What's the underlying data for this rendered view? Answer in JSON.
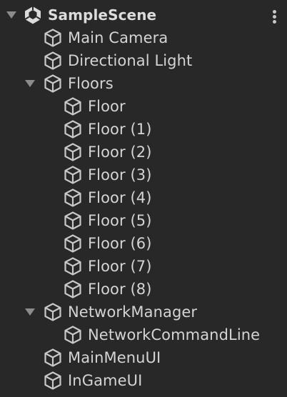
{
  "scene": {
    "name": "SampleScene",
    "icon": "unity-scene-icon",
    "menu_icon": "kebab-menu-icon"
  },
  "items": [
    {
      "label": "Main Camera",
      "depth": 1,
      "icon": "gameobject-cube-icon",
      "has_children": false
    },
    {
      "label": "Directional Light",
      "depth": 1,
      "icon": "gameobject-cube-icon",
      "has_children": false
    },
    {
      "label": "Floors",
      "depth": 1,
      "icon": "gameobject-cube-icon",
      "has_children": true,
      "expanded": true
    },
    {
      "label": "Floor",
      "depth": 2,
      "icon": "gameobject-cube-icon",
      "has_children": false
    },
    {
      "label": "Floor (1)",
      "depth": 2,
      "icon": "gameobject-cube-icon",
      "has_children": false
    },
    {
      "label": "Floor (2)",
      "depth": 2,
      "icon": "gameobject-cube-icon",
      "has_children": false
    },
    {
      "label": "Floor (3)",
      "depth": 2,
      "icon": "gameobject-cube-icon",
      "has_children": false
    },
    {
      "label": "Floor (4)",
      "depth": 2,
      "icon": "gameobject-cube-icon",
      "has_children": false
    },
    {
      "label": "Floor (5)",
      "depth": 2,
      "icon": "gameobject-cube-icon",
      "has_children": false
    },
    {
      "label": "Floor (6)",
      "depth": 2,
      "icon": "gameobject-cube-icon",
      "has_children": false
    },
    {
      "label": "Floor (7)",
      "depth": 2,
      "icon": "gameobject-cube-icon",
      "has_children": false
    },
    {
      "label": "Floor (8)",
      "depth": 2,
      "icon": "gameobject-cube-icon",
      "has_children": false
    },
    {
      "label": "NetworkManager",
      "depth": 1,
      "icon": "gameobject-cube-icon",
      "has_children": true,
      "expanded": true
    },
    {
      "label": "NetworkCommandLine",
      "depth": 2,
      "icon": "gameobject-cube-icon",
      "has_children": false
    },
    {
      "label": "MainMenuUI",
      "depth": 1,
      "icon": "gameobject-cube-icon",
      "has_children": false
    },
    {
      "label": "InGameUI",
      "depth": 1,
      "icon": "gameobject-cube-icon",
      "has_children": false
    }
  ],
  "colors": {
    "background": "#282828",
    "text": "#d4d4d4",
    "icon": "#c8c8c8",
    "foldout": "#8c8c8c"
  }
}
